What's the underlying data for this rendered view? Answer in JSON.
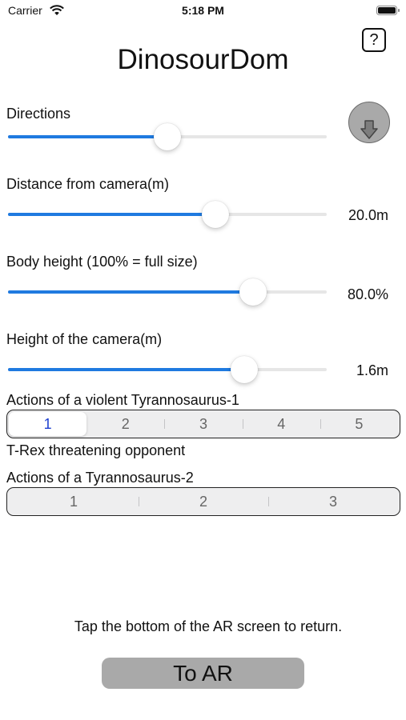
{
  "status_bar": {
    "carrier": "Carrier",
    "time": "5:18 PM"
  },
  "app": {
    "title": "DinosourDom",
    "help_label": "?"
  },
  "directions": {
    "label": "Directions",
    "value_fraction": 0.5
  },
  "distance": {
    "label": "Distance from camera(m)",
    "value": "20.0m",
    "value_fraction": 0.65
  },
  "body_height": {
    "label": "Body height (100% = full size)",
    "value": "80.0%",
    "value_fraction": 0.77
  },
  "camera_height": {
    "label": "Height of the camera(m)",
    "value": "1.6m",
    "value_fraction": 0.74
  },
  "tyrannosaurus1": {
    "label": "Actions of a violent Tyrannosaurus-1",
    "segments": [
      "1",
      "2",
      "3",
      "4",
      "5"
    ],
    "selected": "1",
    "caption": "T-Rex threatening opponent"
  },
  "tyrannosaurus2": {
    "label": "Actions of a Tyrannosaurus-2",
    "segments": [
      "1",
      "2",
      "3"
    ]
  },
  "footer": {
    "hint": "Tap the bottom of the AR screen to return.",
    "button_label": "To AR"
  },
  "colors": {
    "accent": "#1f7ae0",
    "selected_segment_text": "#1c3fd0",
    "button_gray": "#a9a9a9"
  }
}
